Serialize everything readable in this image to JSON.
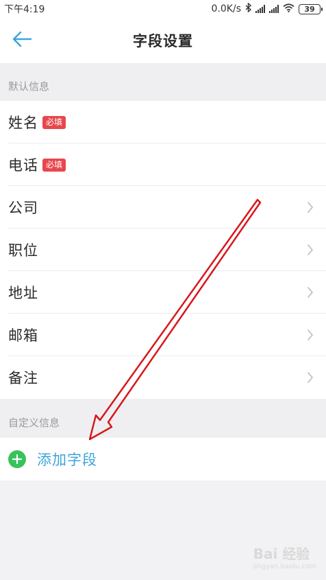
{
  "status_bar": {
    "time": "下午4:19",
    "network_speed": "0.0K/s",
    "battery": "39"
  },
  "header": {
    "title": "字段设置",
    "back_icon": "arrow-left-icon"
  },
  "sections": {
    "default": {
      "label": "默认信息"
    },
    "custom": {
      "label": "自定义信息"
    }
  },
  "fields": [
    {
      "label": "姓名",
      "badge": "必填"
    },
    {
      "label": "电话",
      "badge": "必填"
    },
    {
      "label": "公司"
    },
    {
      "label": "职位"
    },
    {
      "label": "地址"
    },
    {
      "label": "邮箱"
    },
    {
      "label": "备注"
    }
  ],
  "add_field": {
    "label": "添加字段",
    "icon": "plus-circle-icon"
  },
  "colors": {
    "badge": "#e8474d",
    "accent_blue": "#3ba4dd",
    "add_green": "#37c25a",
    "annotation_red": "#d8161d"
  },
  "watermark": {
    "text": "Bai 经验",
    "sub": "jingyan.baidu.com"
  }
}
